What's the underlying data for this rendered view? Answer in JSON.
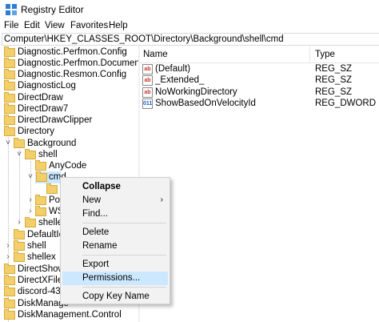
{
  "window": {
    "title": "Registry Editor",
    "icon": "registry-editor-icon"
  },
  "menu": [
    "File",
    "Edit",
    "View",
    "Favorites",
    "Help"
  ],
  "address": "Computer\\HKEY_CLASSES_ROOT\\Directory\\Background\\shell\\cmd",
  "tree": {
    "items": [
      "Diagnostic.Perfmon.Config",
      "Diagnostic.Perfmon.Document",
      "Diagnostic.Resmon.Config",
      "DiagnosticLog",
      "DirectDraw",
      "DirectDraw7",
      "DirectDrawClipper",
      "Directory",
      "Background",
      "shell",
      "AnyCode",
      "cmd",
      "",
      "Pov",
      "WS",
      "shellex",
      "DefaultIco",
      "shell",
      "shellex",
      "DirectShow",
      "DirectXFile",
      "discord-4329",
      "DiskManage",
      "DiskManagement.Control"
    ],
    "expand_glyph": "˅",
    "collapse_glyph": "›"
  },
  "list": {
    "headers": {
      "name": "Name",
      "type": "Type"
    },
    "values": [
      {
        "name": "(Default)",
        "type": "REG_SZ",
        "icon": "ab"
      },
      {
        "name": "_Extended_",
        "type": "REG_SZ",
        "icon": "ab"
      },
      {
        "name": "NoWorkingDirectory",
        "type": "REG_SZ",
        "icon": "ab"
      },
      {
        "name": "ShowBasedOnVelocityId",
        "type": "REG_DWORD",
        "icon": "011"
      }
    ]
  },
  "context_menu": {
    "items": [
      "Collapse",
      "New",
      "Find...",
      "Delete",
      "Rename",
      "Export",
      "Permissions...",
      "Copy Key Name"
    ],
    "submenu_arrow": "›",
    "highlighted": "Permissions..."
  },
  "colors": {
    "folder": "#f2cf6b",
    "selection": "#cce8ff",
    "menu_bg": "#f2f2f2"
  }
}
